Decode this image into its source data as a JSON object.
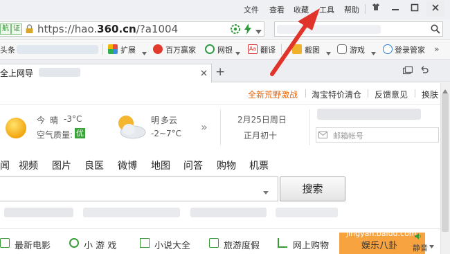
{
  "menu": {
    "items": [
      "文件",
      "查看",
      "收藏",
      "工具",
      "帮助"
    ]
  },
  "address": {
    "verify_badge_1": "航",
    "verify_badge_2": "证",
    "url_prefix": "https://hao.",
    "url_domain": "360.cn",
    "url_suffix": "/?a1004"
  },
  "bookmarks": {
    "left_fragment": "头条",
    "items": [
      "扩展",
      "百万赢家",
      "网银",
      "翻译",
      "截图",
      "游戏",
      "登录管家"
    ]
  },
  "tab": {
    "title": "全上网导",
    "new_tab_symbol": "+"
  },
  "toplinks": [
    "全新荒野激战",
    "淘宝特价清仓",
    "反馈意见",
    "换肤"
  ],
  "weather": {
    "today_label": "今",
    "today_desc": "晴",
    "today_temp": "-3°C",
    "aqi_label": "空气质量:",
    "aqi_value": "优",
    "tomorrow_label": "明",
    "tomorrow_desc": "多云",
    "tomorrow_temp": "-2~7°C",
    "more_symbol": "»"
  },
  "date": {
    "solar": "2月25日周日",
    "lunar": "正月初十"
  },
  "mail": {
    "placeholder": "邮箱帐号"
  },
  "nav_tabs": [
    "闻",
    "视频",
    "图片",
    "良医",
    "微博",
    "地图",
    "问答",
    "购物",
    "机票"
  ],
  "search": {
    "button_label": "搜索"
  },
  "categories": [
    "最新电影",
    "小 游 戏",
    "小说大全",
    "旅游度假",
    "网上购物",
    "娱乐八卦"
  ],
  "watermark": "jingyan.baidu.com",
  "mute_label": "静音",
  "colors": {
    "arrow_red": "#e0342a",
    "toplink_orange": "#e8650a",
    "url_green": "#2e8b2e",
    "yule_orange": "#f6a340"
  }
}
